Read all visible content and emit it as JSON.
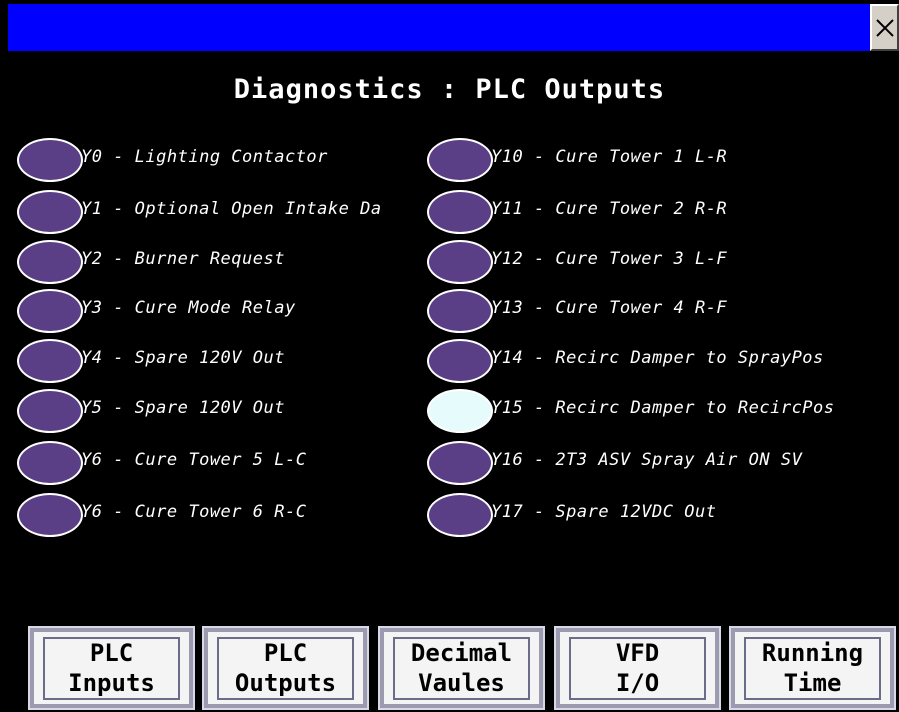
{
  "window": {
    "close_symbol": "✕"
  },
  "heading": "Diagnostics : PLC Outputs",
  "left_outputs": [
    {
      "label": "Y0 - Lighting Contactor",
      "on": false
    },
    {
      "label": "Y1 - Optional Open Intake Da",
      "on": false
    },
    {
      "label": "Y2 - Burner Request",
      "on": false
    },
    {
      "label": "Y3 - Cure Mode Relay",
      "on": false
    },
    {
      "label": "Y4 - Spare 120V Out",
      "on": false
    },
    {
      "label": "Y5 - Spare 120V Out",
      "on": false
    },
    {
      "label": "Y6 - Cure Tower 5 L-C",
      "on": false
    },
    {
      "label": "Y6 - Cure Tower 6 R-C",
      "on": false
    }
  ],
  "right_outputs": [
    {
      "label": "Y10 - Cure Tower 1 L-R",
      "on": false
    },
    {
      "label": "Y11 - Cure Tower 2 R-R",
      "on": false
    },
    {
      "label": "Y12 - Cure Tower 3 L-F",
      "on": false
    },
    {
      "label": "Y13 - Cure Tower 4 R-F",
      "on": false
    },
    {
      "label": "Y14 - Recirc Damper to SprayPos",
      "on": false
    },
    {
      "label": "Y15 - Recirc Damper to RecircPos",
      "on": true
    },
    {
      "label": "Y16 - 2T3 ASV Spray Air ON SV",
      "on": false
    },
    {
      "label": "Y17 - Spare 12VDC Out",
      "on": false
    }
  ],
  "nav": [
    {
      "label": "PLC\nInputs"
    },
    {
      "label": "PLC\nOutputs"
    },
    {
      "label": "Decimal\nVaules"
    },
    {
      "label": "VFD\nI/O"
    },
    {
      "label": "Running\nTime"
    }
  ],
  "colors": {
    "lamp_off": "#5a3e86",
    "lamp_on": "#e6fbfb",
    "titlebar": "#0000ff"
  }
}
